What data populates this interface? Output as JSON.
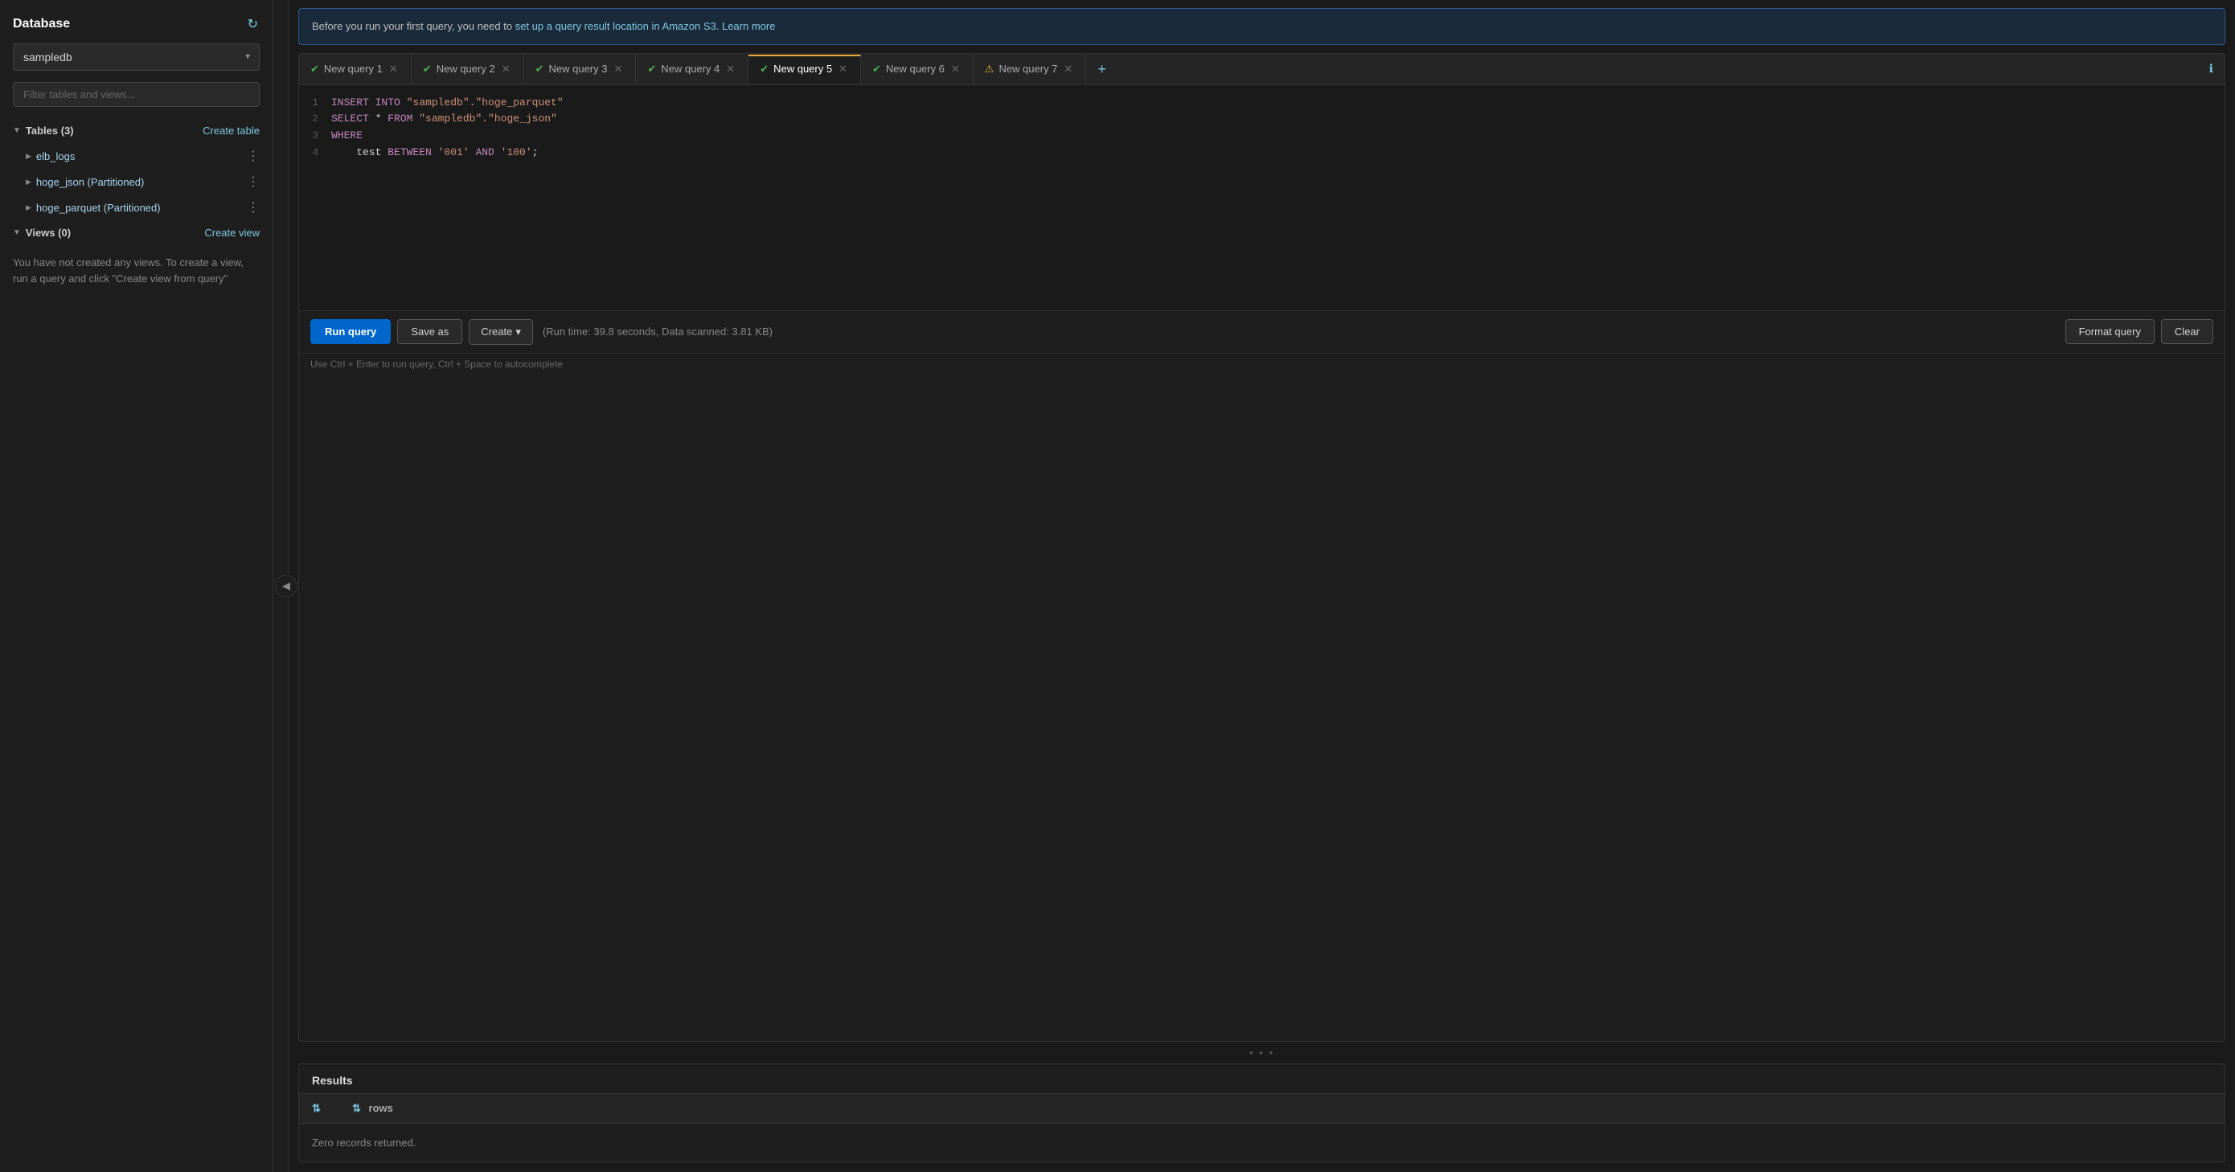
{
  "sidebar": {
    "title": "Database",
    "selected_db": "sampledb",
    "db_options": [
      "sampledb"
    ],
    "filter_placeholder": "Filter tables and views...",
    "tables_section": "Tables (3)",
    "create_table_label": "Create table",
    "create_view_label": "Create view",
    "views_section": "Views (0)",
    "views_empty_text": "You have not created any views. To create a view, run a query and click \"Create view from query\"",
    "tables": [
      {
        "name": "elb_logs"
      },
      {
        "name": "hoge_json (Partitioned)"
      },
      {
        "name": "hoge_parquet (Partitioned)"
      }
    ]
  },
  "info_banner": {
    "text_before": "Before you run your first query, you need to ",
    "link1_text": "set up a query result location in Amazon S3.",
    "link2_text": "Learn more"
  },
  "tabs": [
    {
      "id": "q1",
      "label": "New query 1",
      "status": "ok",
      "active": false
    },
    {
      "id": "q2",
      "label": "New query 2",
      "status": "ok",
      "active": false
    },
    {
      "id": "q3",
      "label": "New query 3",
      "status": "ok",
      "active": false
    },
    {
      "id": "q4",
      "label": "New query 4",
      "status": "ok",
      "active": false
    },
    {
      "id": "q5",
      "label": "New query 5",
      "status": "ok",
      "active": true
    },
    {
      "id": "q6",
      "label": "New query 6",
      "status": "ok",
      "active": false
    },
    {
      "id": "q7",
      "label": "New query 7",
      "status": "warn",
      "active": false
    }
  ],
  "editor": {
    "lines": [
      {
        "num": "1",
        "tokens": [
          {
            "text": "INSERT INTO ",
            "class": "kw-purple"
          },
          {
            "text": "\"sampledb\".\"hoge_parquet\"",
            "class": "kw-string"
          }
        ]
      },
      {
        "num": "2",
        "tokens": [
          {
            "text": "SELECT",
            "class": "kw-purple"
          },
          {
            "text": " * ",
            "class": ""
          },
          {
            "text": "FROM",
            "class": "kw-purple"
          },
          {
            "text": " \"sampledb\".\"hoge_json\"",
            "class": "kw-string"
          }
        ]
      },
      {
        "num": "3",
        "tokens": [
          {
            "text": "WHERE",
            "class": "kw-purple"
          }
        ]
      },
      {
        "num": "4",
        "tokens": [
          {
            "text": "    test ",
            "class": ""
          },
          {
            "text": "BETWEEN",
            "class": "kw-purple"
          },
          {
            "text": " '001' ",
            "class": "kw-string"
          },
          {
            "text": "AND",
            "class": "kw-purple"
          },
          {
            "text": " '100'",
            "class": "kw-string"
          },
          {
            "text": ";",
            "class": ""
          }
        ]
      }
    ]
  },
  "toolbar": {
    "run_label": "Run query",
    "save_as_label": "Save as",
    "create_label": "Create",
    "run_info": "(Run time: 39.8 seconds, Data scanned: 3.81 KB)",
    "format_label": "Format query",
    "clear_label": "Clear",
    "hint": "Use Ctrl + Enter to run query, Ctrl + Space to autocomplete"
  },
  "results": {
    "header": "Results",
    "col1_label": "rows",
    "empty_text": "Zero records returned."
  }
}
